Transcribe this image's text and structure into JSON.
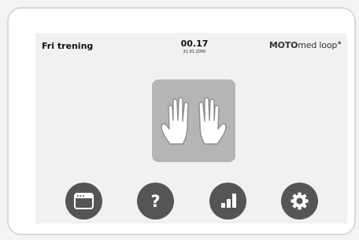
{
  "header": {
    "mode_title": "Fri trening",
    "time": "00.17",
    "date": "21.01.2000",
    "brand_main": "MOTO",
    "brand_light": "med loop",
    "brand_sup": "a"
  },
  "center": {
    "icon": "hands-icon",
    "tile_color": "#b5b5b5"
  },
  "nav": {
    "button_color": "#555555",
    "buttons": [
      {
        "name": "menu",
        "icon": "window-icon"
      },
      {
        "name": "help",
        "icon": "question-icon",
        "glyph": "?"
      },
      {
        "name": "statistics",
        "icon": "bar-chart-icon"
      },
      {
        "name": "settings",
        "icon": "gear-icon"
      }
    ]
  }
}
